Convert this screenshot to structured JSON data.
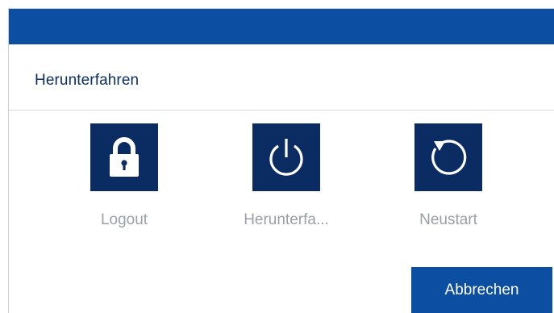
{
  "dialog": {
    "title": "Herunterfahren",
    "titlebar_color": "#0c4fa2",
    "tile_color": "#0b2c63",
    "label_color": "#9aa0a8",
    "actions": [
      {
        "icon": "lock-icon",
        "label": "Logout"
      },
      {
        "icon": "power-icon",
        "label": "Herunterfa..."
      },
      {
        "icon": "restart-icon",
        "label": "Neustart"
      }
    ],
    "cancel_label": "Abbrechen"
  }
}
